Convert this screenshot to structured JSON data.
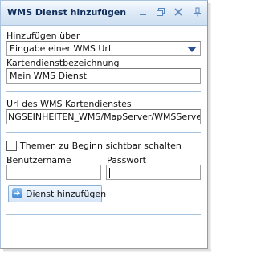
{
  "window": {
    "title": "WMS Dienst hinzufügen",
    "minimize_icon": "minimize-icon",
    "restore_icon": "restore-icon",
    "close_icon": "close-icon",
    "pin_icon": "pin-icon"
  },
  "form": {
    "add_via_label": "Hinzufügen über",
    "add_via_selected": "Eingabe einer WMS Url",
    "service_name_label": "Kartendienstbezeichnung",
    "service_name_value": "Mein WMS Dienst",
    "url_label": "Url des WMS Kartendienstes",
    "url_value": "NGSEINHEITEN_WMS/MapServer/WMSServer?",
    "visible_checkbox_label": "Themen zu Beginn sichtbar schalten",
    "visible_checked": false,
    "username_label": "Benutzername",
    "username_value": "",
    "password_label": "Passwort",
    "password_value": "",
    "add_button_label": "Dienst hinzufügen",
    "add_button_icon": "arrow-right-icon"
  },
  "colors": {
    "accent": "#2a4e96",
    "title_text": "#0f2e5a",
    "separator": "#a9c2de"
  }
}
